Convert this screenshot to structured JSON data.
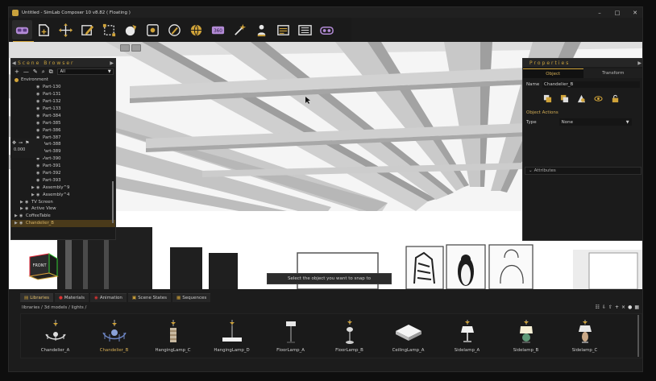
{
  "window": {
    "title": "Untitled - SimLab Composer 10 v8.82 ( Floating )",
    "controls": [
      "–",
      "□",
      "✕"
    ]
  },
  "toolbar": {
    "tools": [
      {
        "name": "vr-headset-icon",
        "active": true
      },
      {
        "name": "scene-import-icon"
      },
      {
        "name": "move-gizmo-icon"
      },
      {
        "name": "edit-object-icon"
      },
      {
        "name": "select-rect-icon"
      },
      {
        "name": "material-ball-icon"
      },
      {
        "name": "camera-frame-icon"
      },
      {
        "name": "pencil-circle-icon"
      },
      {
        "name": "globe-render-icon"
      },
      {
        "name": "360-panorama-icon"
      },
      {
        "name": "magic-wand-icon"
      },
      {
        "name": "user-pin-icon"
      },
      {
        "name": "list-panel-icon"
      },
      {
        "name": "storyboard-icon"
      },
      {
        "name": "vr-viewer-icon"
      }
    ]
  },
  "viewport": {
    "snap_hint": "Select the object you want to snap to",
    "navcube_label": "FRONT"
  },
  "scene_browser": {
    "title": "Scene Browser",
    "filter": "All",
    "tools": [
      "+",
      "—",
      "✎",
      "⌕",
      "⧉"
    ],
    "float_value": "0.000",
    "root": "Environment",
    "items": [
      {
        "label": "Part-130",
        "depth": 3
      },
      {
        "label": "Part-131",
        "depth": 3
      },
      {
        "label": "Part-132",
        "depth": 3
      },
      {
        "label": "Part-133",
        "depth": 3
      },
      {
        "label": "Part-384",
        "depth": 3
      },
      {
        "label": "Part-385",
        "depth": 3
      },
      {
        "label": "Part-386",
        "depth": 3
      },
      {
        "label": "Part-387",
        "depth": 3
      },
      {
        "label": "Part-388",
        "depth": 3
      },
      {
        "label": "Part-389",
        "depth": 3
      },
      {
        "label": "Part-390",
        "depth": 3
      },
      {
        "label": "Part-391",
        "depth": 3
      },
      {
        "label": "Part-392",
        "depth": 3
      },
      {
        "label": "Part-393",
        "depth": 3
      },
      {
        "label": "Assembly^9",
        "depth": 3
      },
      {
        "label": "Assembly^4",
        "depth": 3
      },
      {
        "label": "TV Screen",
        "depth": 1
      },
      {
        "label": "Active View",
        "depth": 1
      },
      {
        "label": "CoffeeTable",
        "depth": 0
      },
      {
        "label": "Chandelier_B",
        "depth": 0,
        "selected": true
      }
    ]
  },
  "properties": {
    "title": "Properties",
    "tabs": [
      "Object",
      "Transform"
    ],
    "active_tab": "Object",
    "name_label": "Name",
    "name_value": "Chandelier_B",
    "section": "Object Actions",
    "type_label": "Type",
    "type_value": "None",
    "attributes": "Attributes"
  },
  "bottom_tabs": [
    "Libraries",
    "Materials",
    "Animation",
    "Scene States",
    "Sequences"
  ],
  "library": {
    "breadcrumb": "libraries  /  3d models  /  lights  /",
    "items": [
      {
        "label": "Chandelier_A"
      },
      {
        "label": "Chandelier_B",
        "selected": true
      },
      {
        "label": "HangingLamp_C"
      },
      {
        "label": "HangingLamp_D"
      },
      {
        "label": "FloorLamp_A"
      },
      {
        "label": "FloorLamp_B"
      },
      {
        "label": "CeilingLamp_A"
      },
      {
        "label": "Sidelamp_A"
      },
      {
        "label": "Sidelamp_B"
      },
      {
        "label": "Sidelamp_C"
      }
    ]
  },
  "colors": {
    "accent": "#d0a339",
    "panel": "#1b1b1b",
    "viewport": "#f3f3f3"
  }
}
